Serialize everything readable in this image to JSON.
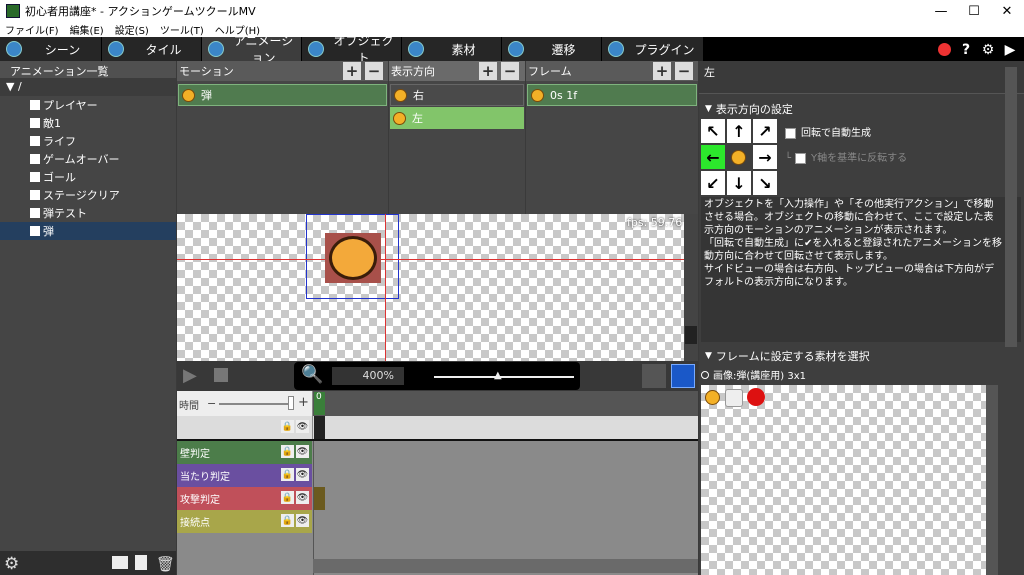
{
  "window": {
    "title": "初心者用講座* - アクションゲームツクールMV",
    "minimize": "—",
    "maximize": "☐",
    "close": "✕"
  },
  "menu": [
    "ファイル(F)",
    "編集(E)",
    "設定(S)",
    "ツール(T)",
    "ヘルプ(H)"
  ],
  "tabs": [
    {
      "label": "シーン",
      "icon": "scene-icon",
      "active": false
    },
    {
      "label": "タイル",
      "icon": "tile-icon",
      "active": false
    },
    {
      "label": "アニメーション",
      "icon": "animation-icon",
      "active": true
    },
    {
      "label": "オブジェクト",
      "icon": "object-icon",
      "active": false
    },
    {
      "label": "素材",
      "icon": "material-icon",
      "active": false
    },
    {
      "label": "遷移",
      "icon": "transition-icon",
      "active": false
    },
    {
      "label": "プラグイン",
      "icon": "plugin-icon",
      "active": false
    }
  ],
  "topright": {
    "help": "?",
    "settings": "⚙",
    "play": "▶"
  },
  "left": {
    "header": "アニメーション一覧",
    "root": "▼ /",
    "items": [
      "プレイヤー",
      "敵1",
      "ライフ",
      "ゲームオーバー",
      "ゴール",
      "ステージクリア",
      "弾テスト",
      "弾"
    ],
    "selected": 7
  },
  "columns": {
    "motion": {
      "header": "モーション",
      "rows": [
        "弾"
      ]
    },
    "direction": {
      "header": "表示方向",
      "rows": [
        "右",
        "左"
      ],
      "selected": 1
    },
    "frame": {
      "header": "フレーム",
      "rows": [
        "0s 1f"
      ]
    }
  },
  "preview": {
    "fps": "fps: 59.76",
    "zoom": "400%"
  },
  "timeline": {
    "time_label": "時間",
    "frame_number": "0",
    "tracks": [
      {
        "label": "",
        "color": "#dcdcdc"
      },
      {
        "label": "壁判定",
        "color": "#4c7d4a"
      },
      {
        "label": "当たり判定",
        "color": "#6a4fa0"
      },
      {
        "label": "攻撃判定",
        "color": "#c0505a"
      },
      {
        "label": "接続点",
        "color": "#a8a64a"
      }
    ]
  },
  "right": {
    "title": "左",
    "dir_section": "表示方向の設定",
    "auto_rotate": "回転で自動生成",
    "flip_y": "Y軸を基準に反転する",
    "description": "オブジェクトを「入力操作」や「その他実行アクション」で移動させる場合。オブジェクトの移動に合わせて、ここで設定した表示方向のモーションのアニメーションが表示されます。\n「回転で自動生成」に✔を入れると登録されたアニメーションを移動方向に合わせて回転させて表示します。\nサイドビューの場合は右方向、トップビューの場合は下方向がデフォルトの表示方向になります。",
    "frame_section": "フレームに設定する素材を選択",
    "image_label": "画像:弾(講座用) 3x1"
  }
}
